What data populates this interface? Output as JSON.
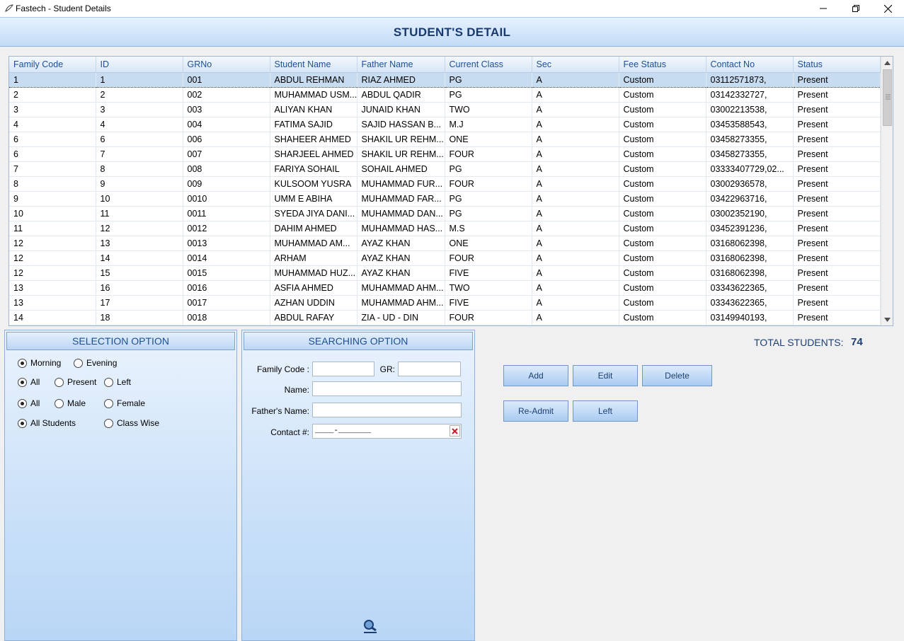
{
  "window": {
    "title": "Fastech - Student Details"
  },
  "header": {
    "title": "STUDENT'S DETAIL"
  },
  "grid": {
    "columns": [
      "Family Code",
      "ID",
      "GRNo",
      "Student Name",
      "Father Name",
      "Current Class",
      "Sec",
      "Fee Status",
      "Contact No",
      "Status"
    ],
    "rows": [
      [
        "1",
        "1",
        "001",
        "ABDUL REHMAN",
        "RIAZ AHMED",
        "PG",
        "A",
        "Custom",
        "03112571873,",
        "Present"
      ],
      [
        "2",
        "2",
        "002",
        "MUHAMMAD USM...",
        "ABDUL QADIR",
        "PG",
        "A",
        "Custom",
        "03142332727,",
        "Present"
      ],
      [
        "3",
        "3",
        "003",
        "ALIYAN KHAN",
        "JUNAID KHAN",
        "TWO",
        "A",
        "Custom",
        "03002213538,",
        "Present"
      ],
      [
        "4",
        "4",
        "004",
        "FATIMA SAJID",
        "SAJID HASSAN B...",
        "M.J",
        "A",
        "Custom",
        "03453588543,",
        "Present"
      ],
      [
        "6",
        "6",
        "006",
        "SHAHEER AHMED",
        "SHAKIL UR REHM...",
        "ONE",
        "A",
        "Custom",
        "03458273355,",
        "Present"
      ],
      [
        "6",
        "7",
        "007",
        "SHARJEEL AHMED",
        "SHAKIL UR REHM...",
        "FOUR",
        "A",
        "Custom",
        "03458273355,",
        "Present"
      ],
      [
        "7",
        "8",
        "008",
        "FARIYA SOHAIL",
        "SOHAIL AHMED",
        "PG",
        "A",
        "Custom",
        "03333407729,02...",
        "Present"
      ],
      [
        "8",
        "9",
        "009",
        "KULSOOM YUSRA",
        "MUHAMMAD FUR...",
        "FOUR",
        "A",
        "Custom",
        "03002936578,",
        "Present"
      ],
      [
        "9",
        "10",
        "0010",
        "UMM E ABIHA",
        "MUHAMMAD FAR...",
        "PG",
        "A",
        "Custom",
        "03422963716,",
        "Present"
      ],
      [
        "10",
        "11",
        "0011",
        "SYEDA JIYA DANI...",
        "MUHAMMAD DAN...",
        "PG",
        "A",
        "Custom",
        "03002352190,",
        "Present"
      ],
      [
        "11",
        "12",
        "0012",
        "DAHIM AHMED",
        "MUHAMMAD HAS...",
        "M.S",
        "A",
        "Custom",
        "03452391236,",
        "Present"
      ],
      [
        "12",
        "13",
        "0013",
        "MUHAMMAD AM...",
        "AYAZ KHAN",
        "ONE",
        "A",
        "Custom",
        "03168062398,",
        "Present"
      ],
      [
        "12",
        "14",
        "0014",
        "ARHAM",
        "AYAZ KHAN",
        "FOUR",
        "A",
        "Custom",
        "03168062398,",
        "Present"
      ],
      [
        "12",
        "15",
        "0015",
        "MUHAMMAD HUZ...",
        "AYAZ KHAN",
        "FIVE",
        "A",
        "Custom",
        "03168062398,",
        "Present"
      ],
      [
        "13",
        "16",
        "0016",
        "ASFIA AHMED",
        "MUHAMMAD AHM...",
        "TWO",
        "A",
        "Custom",
        "03343622365,",
        "Present"
      ],
      [
        "13",
        "17",
        "0017",
        "AZHAN UDDIN",
        "MUHAMMAD AHM...",
        "FIVE",
        "A",
        "Custom",
        "03343622365,",
        "Present"
      ],
      [
        "14",
        "18",
        "0018",
        "ABDUL RAFAY",
        "ZIA - UD - DIN",
        "FOUR",
        "A",
        "Custom",
        "03149940193,",
        "Present"
      ]
    ],
    "selected_row": 0
  },
  "selection": {
    "title": "SELECTION OPTION",
    "shift": {
      "options": [
        "Morning",
        "Evening"
      ],
      "selected": "Morning"
    },
    "presence": {
      "options": [
        "All",
        "Present",
        "Left"
      ],
      "selected": "All"
    },
    "gender": {
      "options": [
        "All",
        "Male",
        "Female"
      ],
      "selected": "All"
    },
    "scope": {
      "options": [
        "All Students",
        "Class Wise"
      ],
      "selected": "All Students"
    }
  },
  "search": {
    "title": "SEARCHING OPTION",
    "family_code_label": "Family Code :",
    "family_code_value": "",
    "gr_label": "GR:",
    "gr_value": "",
    "name_label": "Name:",
    "name_value": "",
    "father_label": "Father's Name:",
    "father_value": "",
    "contact_label": "Contact #:",
    "contact_value": "____-_______"
  },
  "actions": {
    "add": "Add",
    "edit": "Edit",
    "delete": "Delete",
    "readmit": "Re-Admit",
    "left": "Left"
  },
  "totals": {
    "label": "TOTAL STUDENTS:",
    "value": "74"
  },
  "colors": {
    "header_text": "#1a3a6e",
    "column_header_text": "#1e4f93",
    "selected_row": "#c8dcf1",
    "panel_gradient_top": "#eaf3fd",
    "panel_gradient_bottom": "#b9d6f6",
    "clear_icon": "#c0202a"
  }
}
